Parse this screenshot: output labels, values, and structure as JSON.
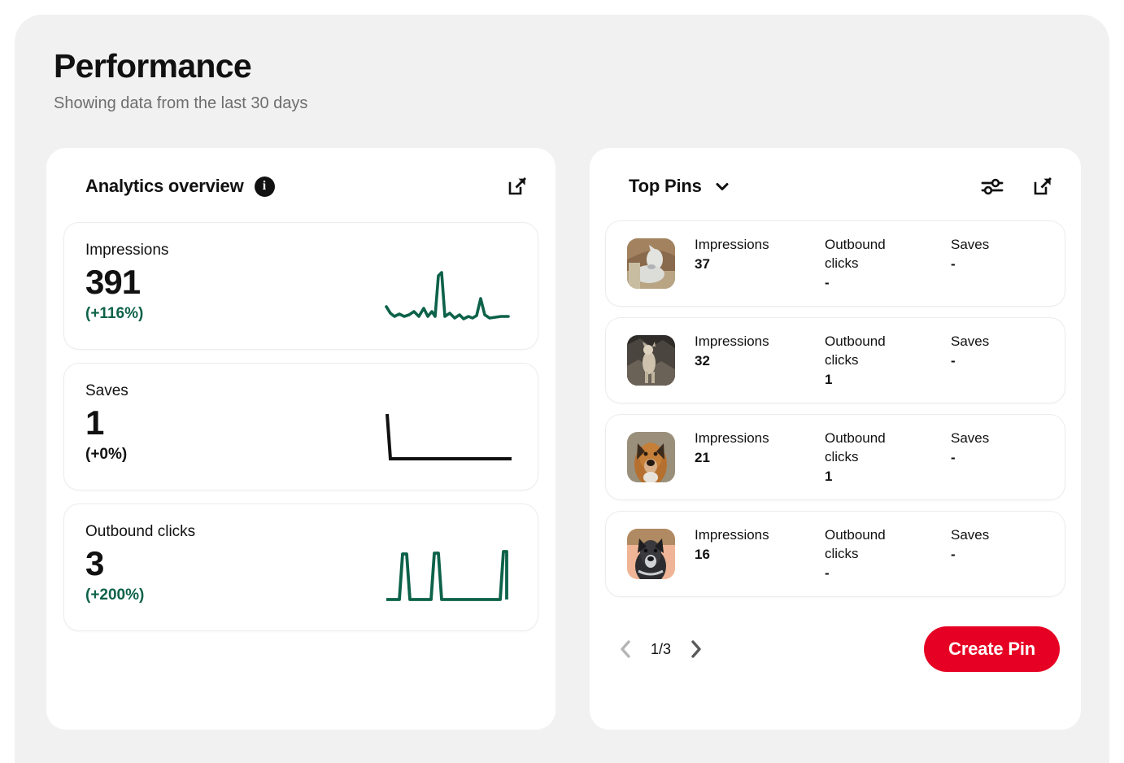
{
  "header": {
    "title": "Performance",
    "subtitle": "Showing data from the last 30 days"
  },
  "colors": {
    "brand_red": "#e60023",
    "positive_green": "#0d6249",
    "neutral_black": "#111111",
    "page_bg": "#f1f1f1",
    "card_bg": "#ffffff"
  },
  "analytics_panel": {
    "title": "Analytics overview",
    "info_icon_label": "i",
    "expand_icon": "external-link-icon",
    "metrics": [
      {
        "label": "Impressions",
        "value": "391",
        "delta": "(+116%)",
        "delta_color": "#0d6249",
        "spark_color": "#0d6249"
      },
      {
        "label": "Saves",
        "value": "1",
        "delta": "(+0%)",
        "delta_color": "#111111",
        "spark_color": "#111111"
      },
      {
        "label": "Outbound clicks",
        "value": "3",
        "delta": "(+200%)",
        "delta_color": "#0d6249",
        "spark_color": "#0d6249"
      }
    ]
  },
  "top_pins_panel": {
    "title": "Top Pins",
    "dropdown_icon": "chevron-down-icon",
    "filter_icon": "filter-sliders-icon",
    "expand_icon": "external-link-icon",
    "column_labels": {
      "impressions": "Impressions",
      "outbound_clicks": "Outbound clicks",
      "saves": "Saves"
    },
    "rows": [
      {
        "impressions": "37",
        "outbound_clicks": "-",
        "saves": "-",
        "thumb": "white-dog-on-couch"
      },
      {
        "impressions": "32",
        "outbound_clicks": "1",
        "saves": "-",
        "thumb": "dog-on-rocks"
      },
      {
        "impressions": "21",
        "outbound_clicks": "1",
        "saves": "-",
        "thumb": "brown-dog-portrait"
      },
      {
        "impressions": "16",
        "outbound_clicks": "-",
        "saves": "-",
        "thumb": "speckled-dog-portrait"
      }
    ],
    "pagination": {
      "label": "1/3",
      "prev_icon": "chevron-left-icon",
      "next_icon": "chevron-right-icon",
      "prev_enabled": false,
      "next_enabled": true
    },
    "create_pin_label": "Create Pin"
  },
  "chart_data": [
    {
      "type": "line",
      "title": "Impressions",
      "ylabel": "Impressions",
      "total": 391,
      "change_pct": 116,
      "values": [
        28,
        10,
        20,
        14,
        16,
        15,
        20,
        13,
        24,
        12,
        22,
        10,
        100,
        12,
        9,
        14,
        10,
        16,
        11,
        13,
        12,
        10,
        42,
        10,
        13
      ],
      "ylim": [
        0,
        100
      ],
      "grid": false,
      "legend": "none"
    },
    {
      "type": "line",
      "title": "Saves",
      "ylabel": "Saves",
      "total": 1,
      "change_pct": 0,
      "values": [
        100,
        0,
        0,
        0,
        0,
        0,
        0,
        0,
        0,
        0,
        0,
        0,
        0,
        0,
        0,
        0,
        0,
        0,
        0,
        0
      ],
      "ylim": [
        0,
        100
      ],
      "grid": false,
      "legend": "none"
    },
    {
      "type": "line",
      "title": "Outbound clicks",
      "ylabel": "Outbound clicks",
      "total": 3,
      "change_pct": 200,
      "values": [
        0,
        0,
        0,
        100,
        0,
        0,
        0,
        0,
        100,
        0,
        0,
        0,
        0,
        0,
        0,
        0,
        0,
        0,
        100
      ],
      "ylim": [
        0,
        100
      ],
      "grid": false,
      "legend": "none"
    }
  ]
}
